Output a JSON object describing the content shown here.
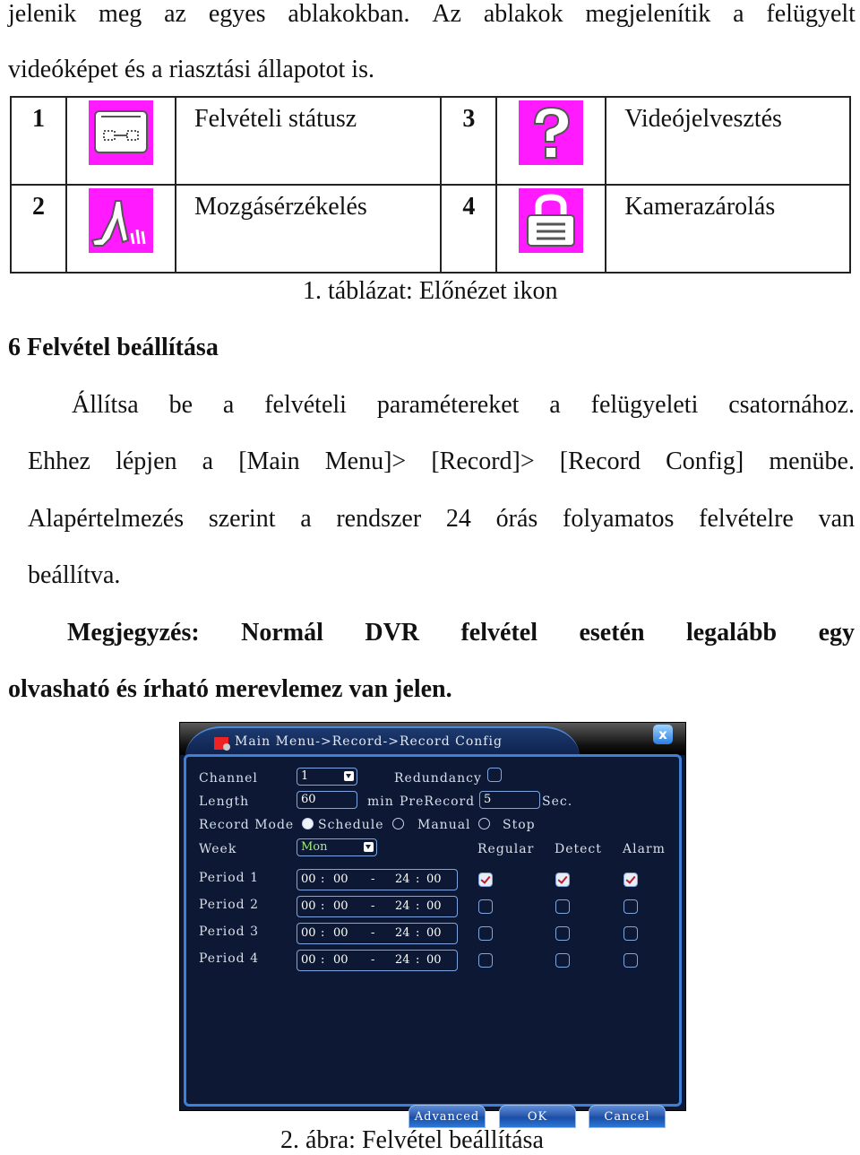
{
  "intro": {
    "line1": [
      "jelenik",
      "meg",
      "az",
      "egyes",
      "ablakokban.",
      "Az",
      "ablakok",
      "megjelenítik",
      "a",
      "felügyelt"
    ],
    "line2": "videóképet és a riasztási állapotot is."
  },
  "icon_table": {
    "rows": [
      {
        "left_num": "1",
        "left_icon": "record-status-icon",
        "left_label": "Felvételi státusz",
        "right_num": "3",
        "right_icon": "video-loss-icon",
        "right_label": "Videójelvesztés"
      },
      {
        "left_num": "2",
        "left_icon": "motion-detect-icon",
        "left_label": "Mozgásérzékelés",
        "right_num": "4",
        "right_icon": "camera-lock-icon",
        "right_label": "Kamerazárolás"
      }
    ],
    "icon_color": "#ff1aff",
    "caption": "1. táblázat: Előnézet ikon"
  },
  "section": {
    "heading": "6 Felvétel beállítása",
    "para1_line1": [
      "Állítsa",
      "be",
      "a",
      "felvételi",
      "paramétereket",
      "a",
      "felügyeleti",
      "csatornához."
    ],
    "para1_line2": [
      "Ehhez",
      "lépjen",
      "a",
      "[Main",
      "Menu]>",
      "[Record]>",
      "[Record",
      "Config]",
      "menübe."
    ],
    "para1_line3": [
      "Alapértelmezés",
      "szerint",
      "a",
      "rendszer",
      "24",
      "órás",
      "folyamatos",
      "felvételre",
      "van"
    ],
    "para1_line4": "beállítva.",
    "note_line1": [
      "Megjegyzés:",
      "Normál",
      "DVR",
      "felvétel",
      "esetén",
      "legalább",
      "egy"
    ],
    "note_line2": "olvasható és írható merevlemez van jelen."
  },
  "dvr": {
    "title": "Main Menu->Record->Record Config",
    "close_label": "x",
    "channel_label": "Channel",
    "channel_value": "1",
    "redundancy_label": "Redundancy",
    "redundancy_checked": false,
    "length_label": "Length",
    "length_value": "60",
    "length_unit": "min",
    "prerecord_label": "PreRecord",
    "prerecord_value": "5",
    "prerecord_unit": "Sec.",
    "record_mode_label": "Record Mode",
    "modes": [
      {
        "label": "Schedule",
        "selected": true
      },
      {
        "label": "Manual",
        "selected": false
      },
      {
        "label": "Stop",
        "selected": false
      }
    ],
    "week_label": "Week",
    "week_value": "Mon",
    "col_headers": [
      "Regular",
      "Detect",
      "Alarm"
    ],
    "periods": [
      {
        "label": "Period 1",
        "start_h": "00",
        "start_m": "00",
        "end_h": "24",
        "end_m": "00",
        "regular": true,
        "detect": true,
        "alarm": true
      },
      {
        "label": "Period 2",
        "start_h": "00",
        "start_m": "00",
        "end_h": "24",
        "end_m": "00",
        "regular": false,
        "detect": false,
        "alarm": false
      },
      {
        "label": "Period 3",
        "start_h": "00",
        "start_m": "00",
        "end_h": "24",
        "end_m": "00",
        "regular": false,
        "detect": false,
        "alarm": false
      },
      {
        "label": "Period 4",
        "start_h": "00",
        "start_m": "00",
        "end_h": "24",
        "end_m": "00",
        "regular": false,
        "detect": false,
        "alarm": false
      }
    ],
    "buttons": {
      "advanced": "Advanced",
      "ok": "OK",
      "cancel": "Cancel"
    }
  },
  "figure_caption": "2. ábra: Felvétel beállítása"
}
